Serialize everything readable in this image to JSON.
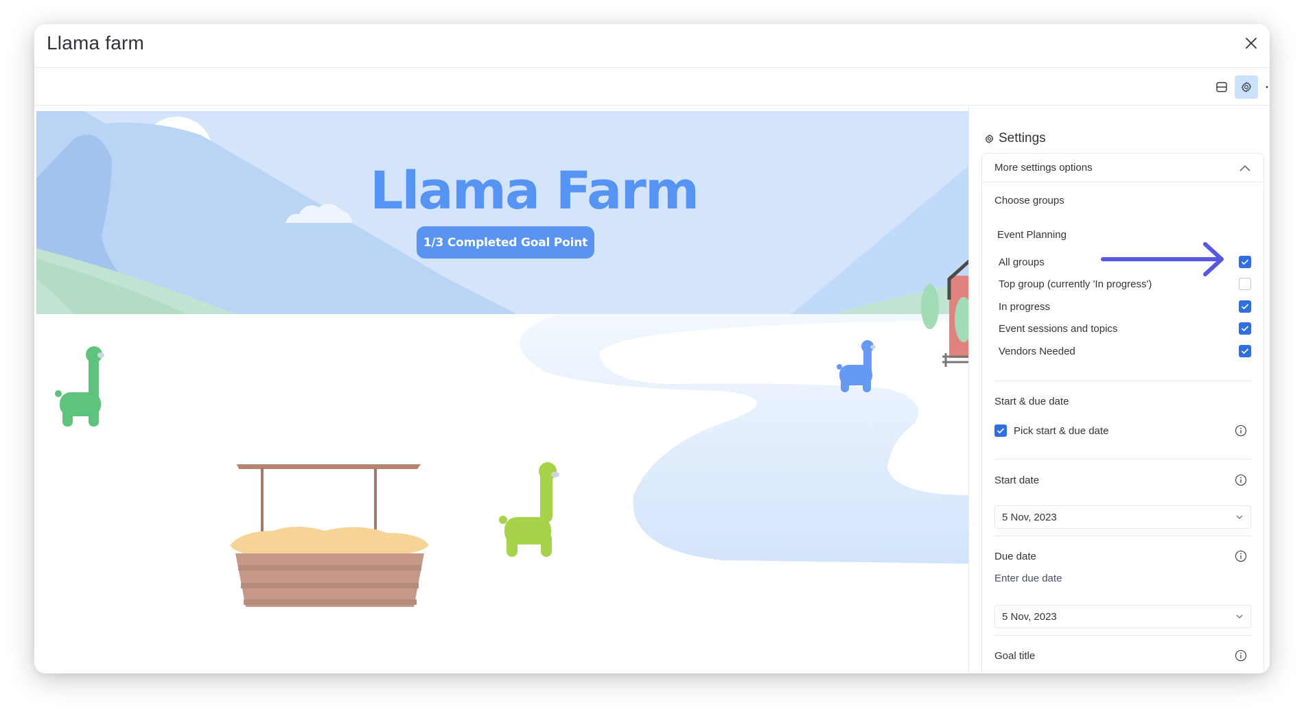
{
  "window": {
    "title": "Llama farm",
    "close_icon": "close-icon"
  },
  "toolbar": {
    "buttons": [
      {
        "icon": "layout-split-icon",
        "active": false
      },
      {
        "icon": "gear-icon",
        "active": true
      },
      {
        "icon": "more-horizontal-icon",
        "active": false
      }
    ]
  },
  "scene": {
    "title": "Llama Farm",
    "goal_badge": "1/3 Completed Goal Point",
    "colors": {
      "title": "#5694f4",
      "badge": "#5a94f3",
      "sky": "#d3e4fb",
      "barn": "#e0837f"
    }
  },
  "settings": {
    "header": "Settings",
    "section_toggle": "More settings options",
    "choose_groups_label": "Choose groups",
    "board_name": "Event Planning",
    "groups": [
      {
        "label": "All groups",
        "checked": true
      },
      {
        "label": "Top group (currently 'In progress')",
        "checked": false
      },
      {
        "label": "In progress",
        "checked": true
      },
      {
        "label": "Event sessions and topics",
        "checked": true
      },
      {
        "label": "Vendors Needed",
        "checked": true
      }
    ],
    "start_due_section": "Start & due date",
    "pick_dates_label": "Pick start & due date",
    "pick_dates_checked": true,
    "start_date_label": "Start date",
    "start_date_value": "5 Nov, 2023",
    "due_date_label": "Due date",
    "due_date_hint": "Enter due date",
    "due_date_value": "5 Nov, 2023",
    "goal_title_label": "Goal title",
    "checkbox_color": "#2f6fe0",
    "annotation_arrow_color": "#5557e0"
  }
}
